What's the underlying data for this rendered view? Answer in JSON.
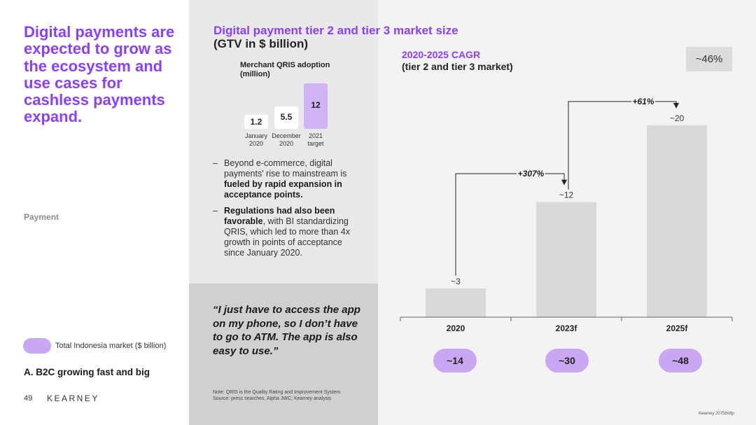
{
  "headline": "Digital payments are expected to grow as the ecosystem and use cases for cashless payments expand.",
  "section_tag": "Payment",
  "legend": {
    "label": "Total Indonesia market ($ billion)",
    "color": "#c9a7f2"
  },
  "b2c_label": "A. B2C growing fast and big",
  "page_number": "49",
  "brand": "KEARNEY",
  "chart_title": "Digital payment tier 2 and tier 3 market size",
  "chart_subtitle": "(GTV in $ billion)",
  "qris": {
    "title": "Merchant QRIS adoption (million)",
    "items": [
      {
        "value": "1.2",
        "label1": "January",
        "label2": "2020"
      },
      {
        "value": "5.5",
        "label1": "December",
        "label2": "2020"
      },
      {
        "value": "12",
        "label1": "2021",
        "label2": "target"
      }
    ]
  },
  "bullets": {
    "b1_plain": "Beyond e-commerce, digital payments' rise to mainstream is ",
    "b1_bold": "fueled by rapid expansion in acceptance points.",
    "b2_bold": "Regulations had also been favorable",
    "b2_plain": ", with BI standardizing QRIS, which led to more than 4x growth in points of acceptance since January 2020."
  },
  "quote": "“I just have to access the app on my phone, so I don’t have to go to ATM. The app is also easy to use.”",
  "note_line1": "Note: QRIS is the Quality Rating and Improvement System.",
  "note_line2": "Source: press searches, Alpha JWC; Kearney analysis",
  "cagr": {
    "title": "2020-2025 CAGR",
    "subtitle": "(tier 2 and tier 3 market)",
    "value": "~46%"
  },
  "growth_labels": [
    "+307%",
    "+61%"
  ],
  "totals": [
    "~14",
    "~30",
    "~48"
  ],
  "footer_id": "Kearney 20758/dtp",
  "colors": {
    "accent": "#8a3ffc",
    "bar": "#d9d9d9",
    "pill": "#c9a7f2"
  },
  "chart_data": {
    "type": "bar",
    "categories": [
      "2020",
      "2023f",
      "2025f"
    ],
    "values": [
      3,
      12,
      20
    ],
    "value_labels": [
      "~3",
      "~12",
      "~20"
    ],
    "title": "Digital payment tier 2 and tier 3 market size",
    "ylabel": "(GTV in $ billion)",
    "ylim": [
      0,
      20
    ]
  }
}
